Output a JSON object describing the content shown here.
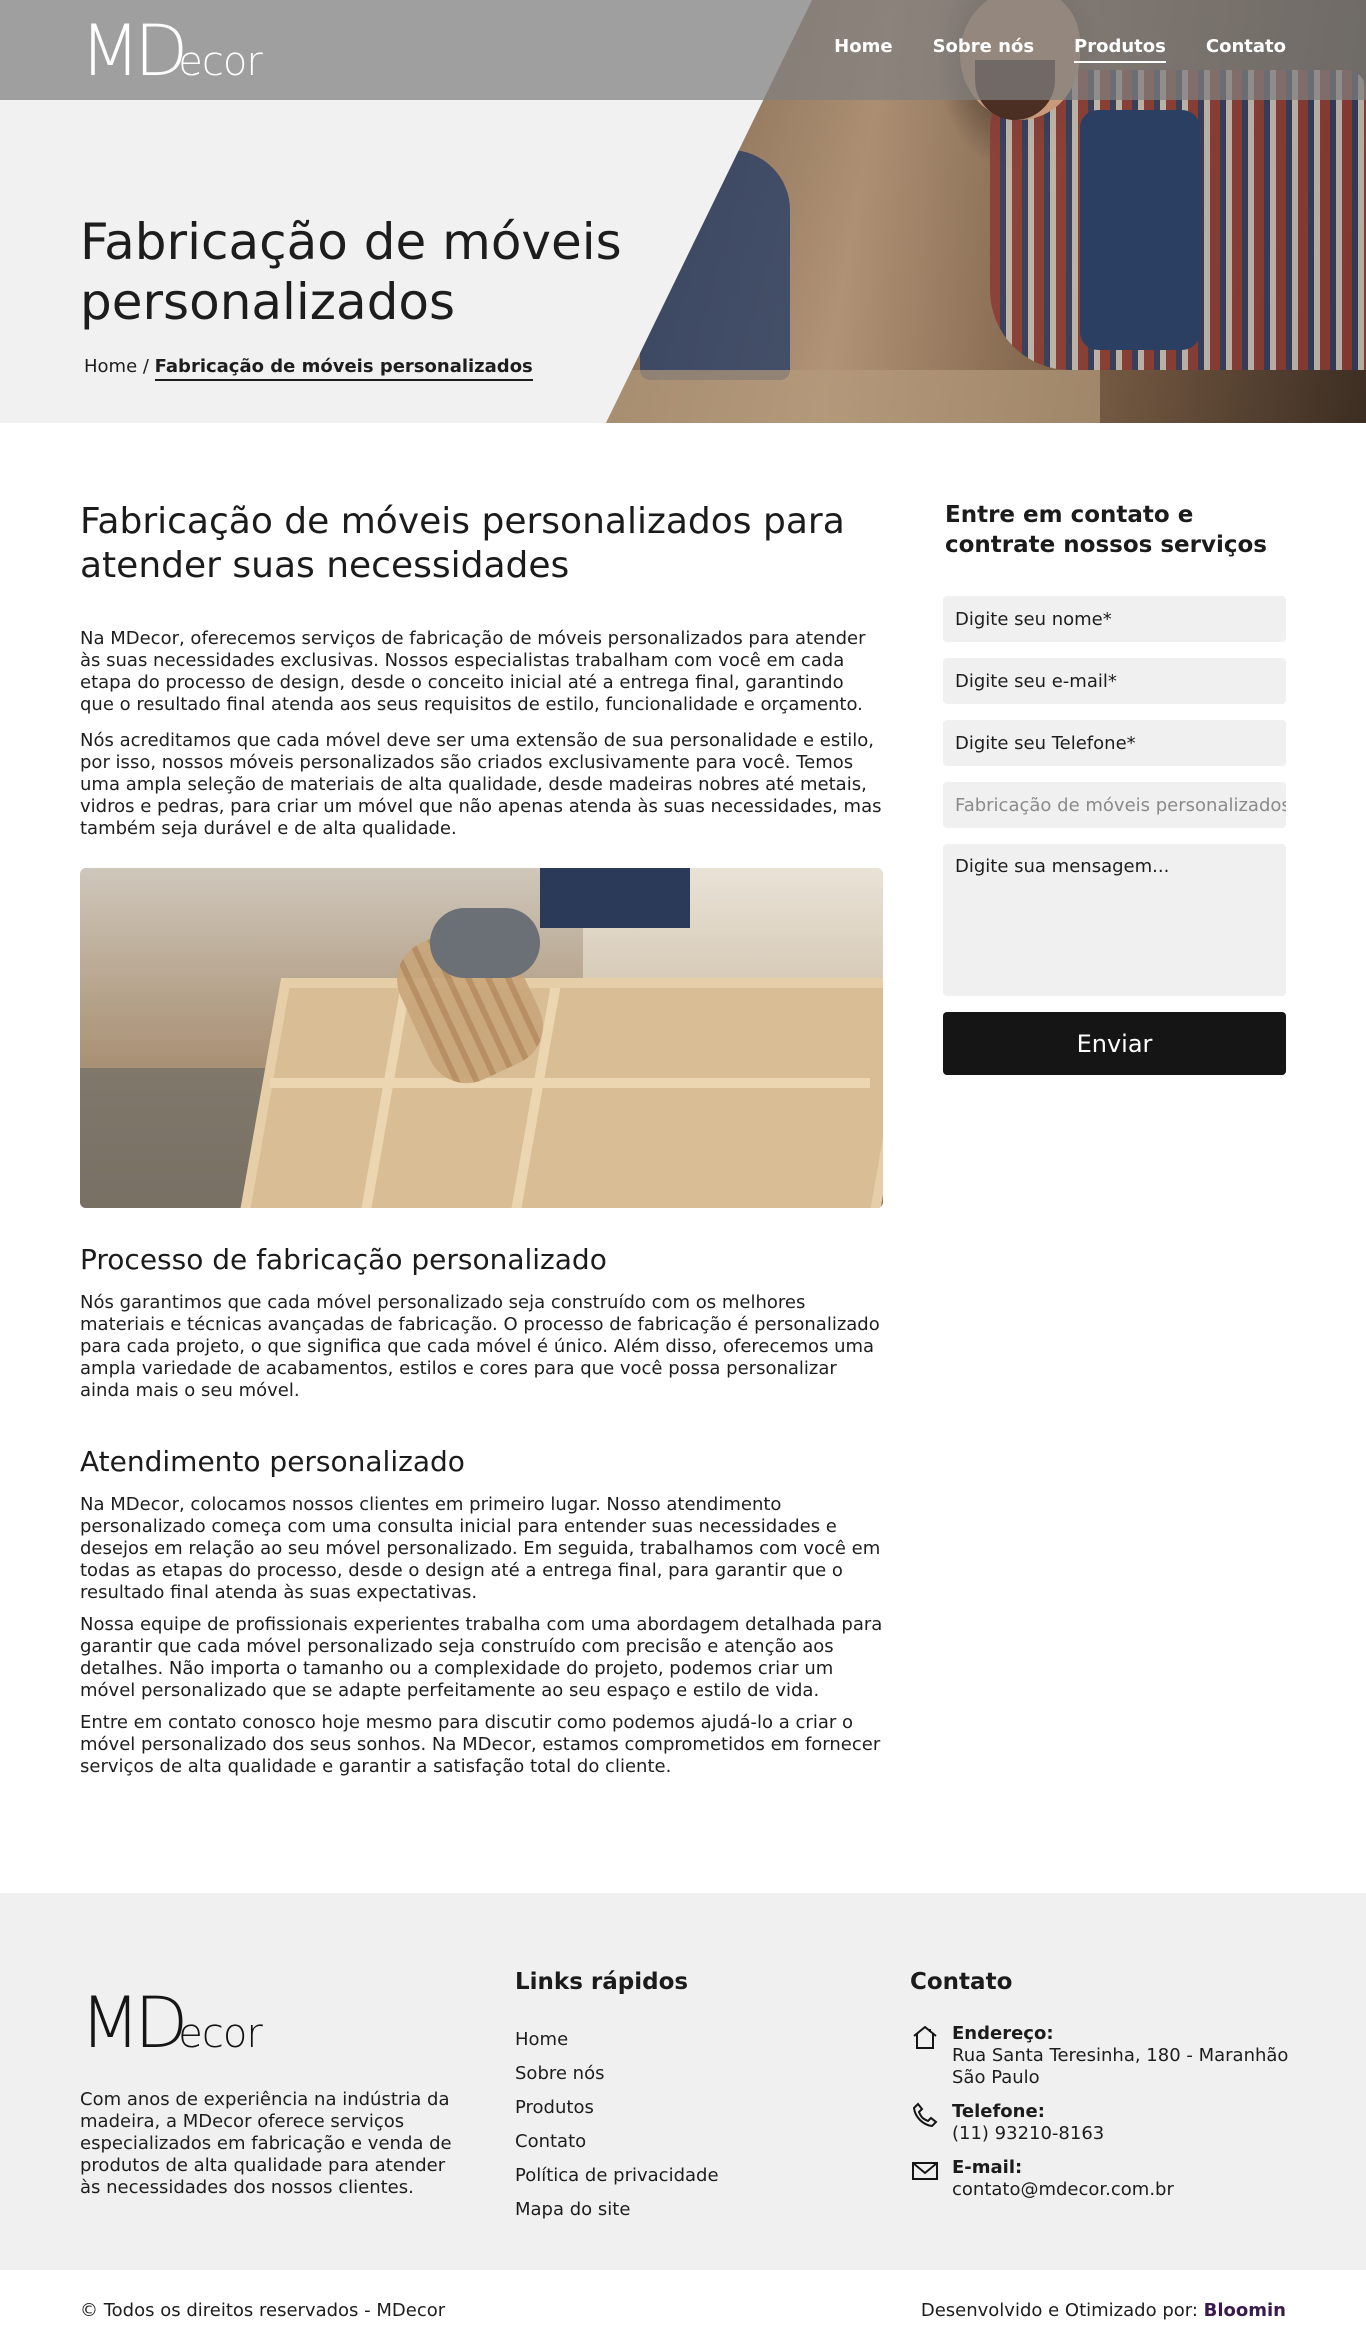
{
  "brand": {
    "logo_big": "MD",
    "logo_small": "ecor"
  },
  "nav": {
    "items": [
      "Home",
      "Sobre nós",
      "Produtos",
      "Contato"
    ],
    "active": "Produtos"
  },
  "hero": {
    "title": "Fabricação de móveis personalizados",
    "breadcrumb_home": "Home",
    "breadcrumb_sep": " / ",
    "breadcrumb_current": "Fabricação de móveis personalizados"
  },
  "main": {
    "heading": "Fabricação de móveis personalizados para atender suas necessidades",
    "intro_p1": "Na MDecor, oferecemos serviços de fabricação de móveis personalizados para atender às suas necessidades exclusivas. Nossos especialistas trabalham com você em cada etapa do processo de design, desde o conceito inicial até a entrega final, garantindo que o resultado final atenda aos seus requisitos de estilo, funcionalidade e orçamento.",
    "intro_p2": "Nós acreditamos que cada móvel deve ser uma extensão de sua personalidade e estilo, por isso, nossos móveis personalizados são criados exclusivamente para você. Temos uma ampla seleção de materiais de alta qualidade, desde madeiras nobres até metais, vidros e pedras, para criar um móvel que não apenas atenda às suas necessidades, mas também seja durável e de alta qualidade.",
    "process_heading": "Processo de fabricação personalizado",
    "process_p": "Nós garantimos que cada móvel personalizado seja construído com os melhores materiais e técnicas avançadas de fabricação. O processo de fabricação é personalizado para cada projeto, o que significa que cada móvel é único. Além disso, oferecemos uma ampla variedade de acabamentos, estilos e cores para que você possa personalizar ainda mais o seu móvel.",
    "service_heading": "Atendimento personalizado",
    "service_p1": "Na MDecor, colocamos nossos clientes em primeiro lugar. Nosso atendimento personalizado começa com uma consulta inicial para entender suas necessidades e desejos em relação ao seu móvel personalizado. Em seguida, trabalhamos com você em todas as etapas do processo, desde o design até a entrega final, para garantir que o resultado final atenda às suas expectativas.",
    "service_p2": "Nossa equipe de profissionais experientes trabalha com uma abordagem detalhada para garantir que cada móvel personalizado seja construído com precisão e atenção aos detalhes. Não importa o tamanho ou a complexidade do projeto, podemos criar um móvel personalizado que se adapte perfeitamente ao seu espaço e estilo de vida.",
    "service_p3": "Entre em contato conosco hoje mesmo para discutir como podemos ajudá-lo a criar o móvel personalizado dos seus sonhos. Na MDecor, estamos comprometidos em fornecer serviços de alta qualidade e garantir a satisfação total do cliente."
  },
  "form": {
    "heading": "Entre em contato e contrate nossos serviços",
    "name_placeholder": "Digite seu nome*",
    "email_placeholder": "Digite seu e-mail*",
    "phone_placeholder": "Digite seu Telefone*",
    "service_value": "Fabricação de móveis personalizados",
    "message_placeholder": "Digite sua mensagem...",
    "submit_label": "Enviar"
  },
  "footer": {
    "about": "Com anos de experiência na indústria da madeira, a MDecor oferece serviços especializados em fabricação e venda de produtos de alta qualidade para atender às necessidades dos nossos clientes.",
    "links_heading": "Links rápidos",
    "links": [
      "Home",
      "Sobre nós",
      "Produtos",
      "Contato",
      "Política de privacidade",
      "Mapa do site"
    ],
    "contact_heading": "Contato",
    "address_label": "Endereço:",
    "address_value": "Rua Santa Teresinha, 180 - Maranhão São Paulo",
    "phone_label": "Telefone:",
    "phone_value": "(11) 93210-8163",
    "email_label": "E-mail:",
    "email_value": "contato@mdecor.com.br",
    "icons": [
      "home-icon",
      "phone-icon",
      "mail-icon"
    ]
  },
  "copyright": {
    "left": "© Todos os direitos reservados - MDecor",
    "right_prefix": "Desenvolvido e Otimizado por: ",
    "right_brand": "Bloomin"
  },
  "colors": {
    "button": "#151515",
    "field_bg": "#f0f0f0",
    "footer_bg": "#f0f0f0",
    "brand_link": "#3a1a4a"
  }
}
